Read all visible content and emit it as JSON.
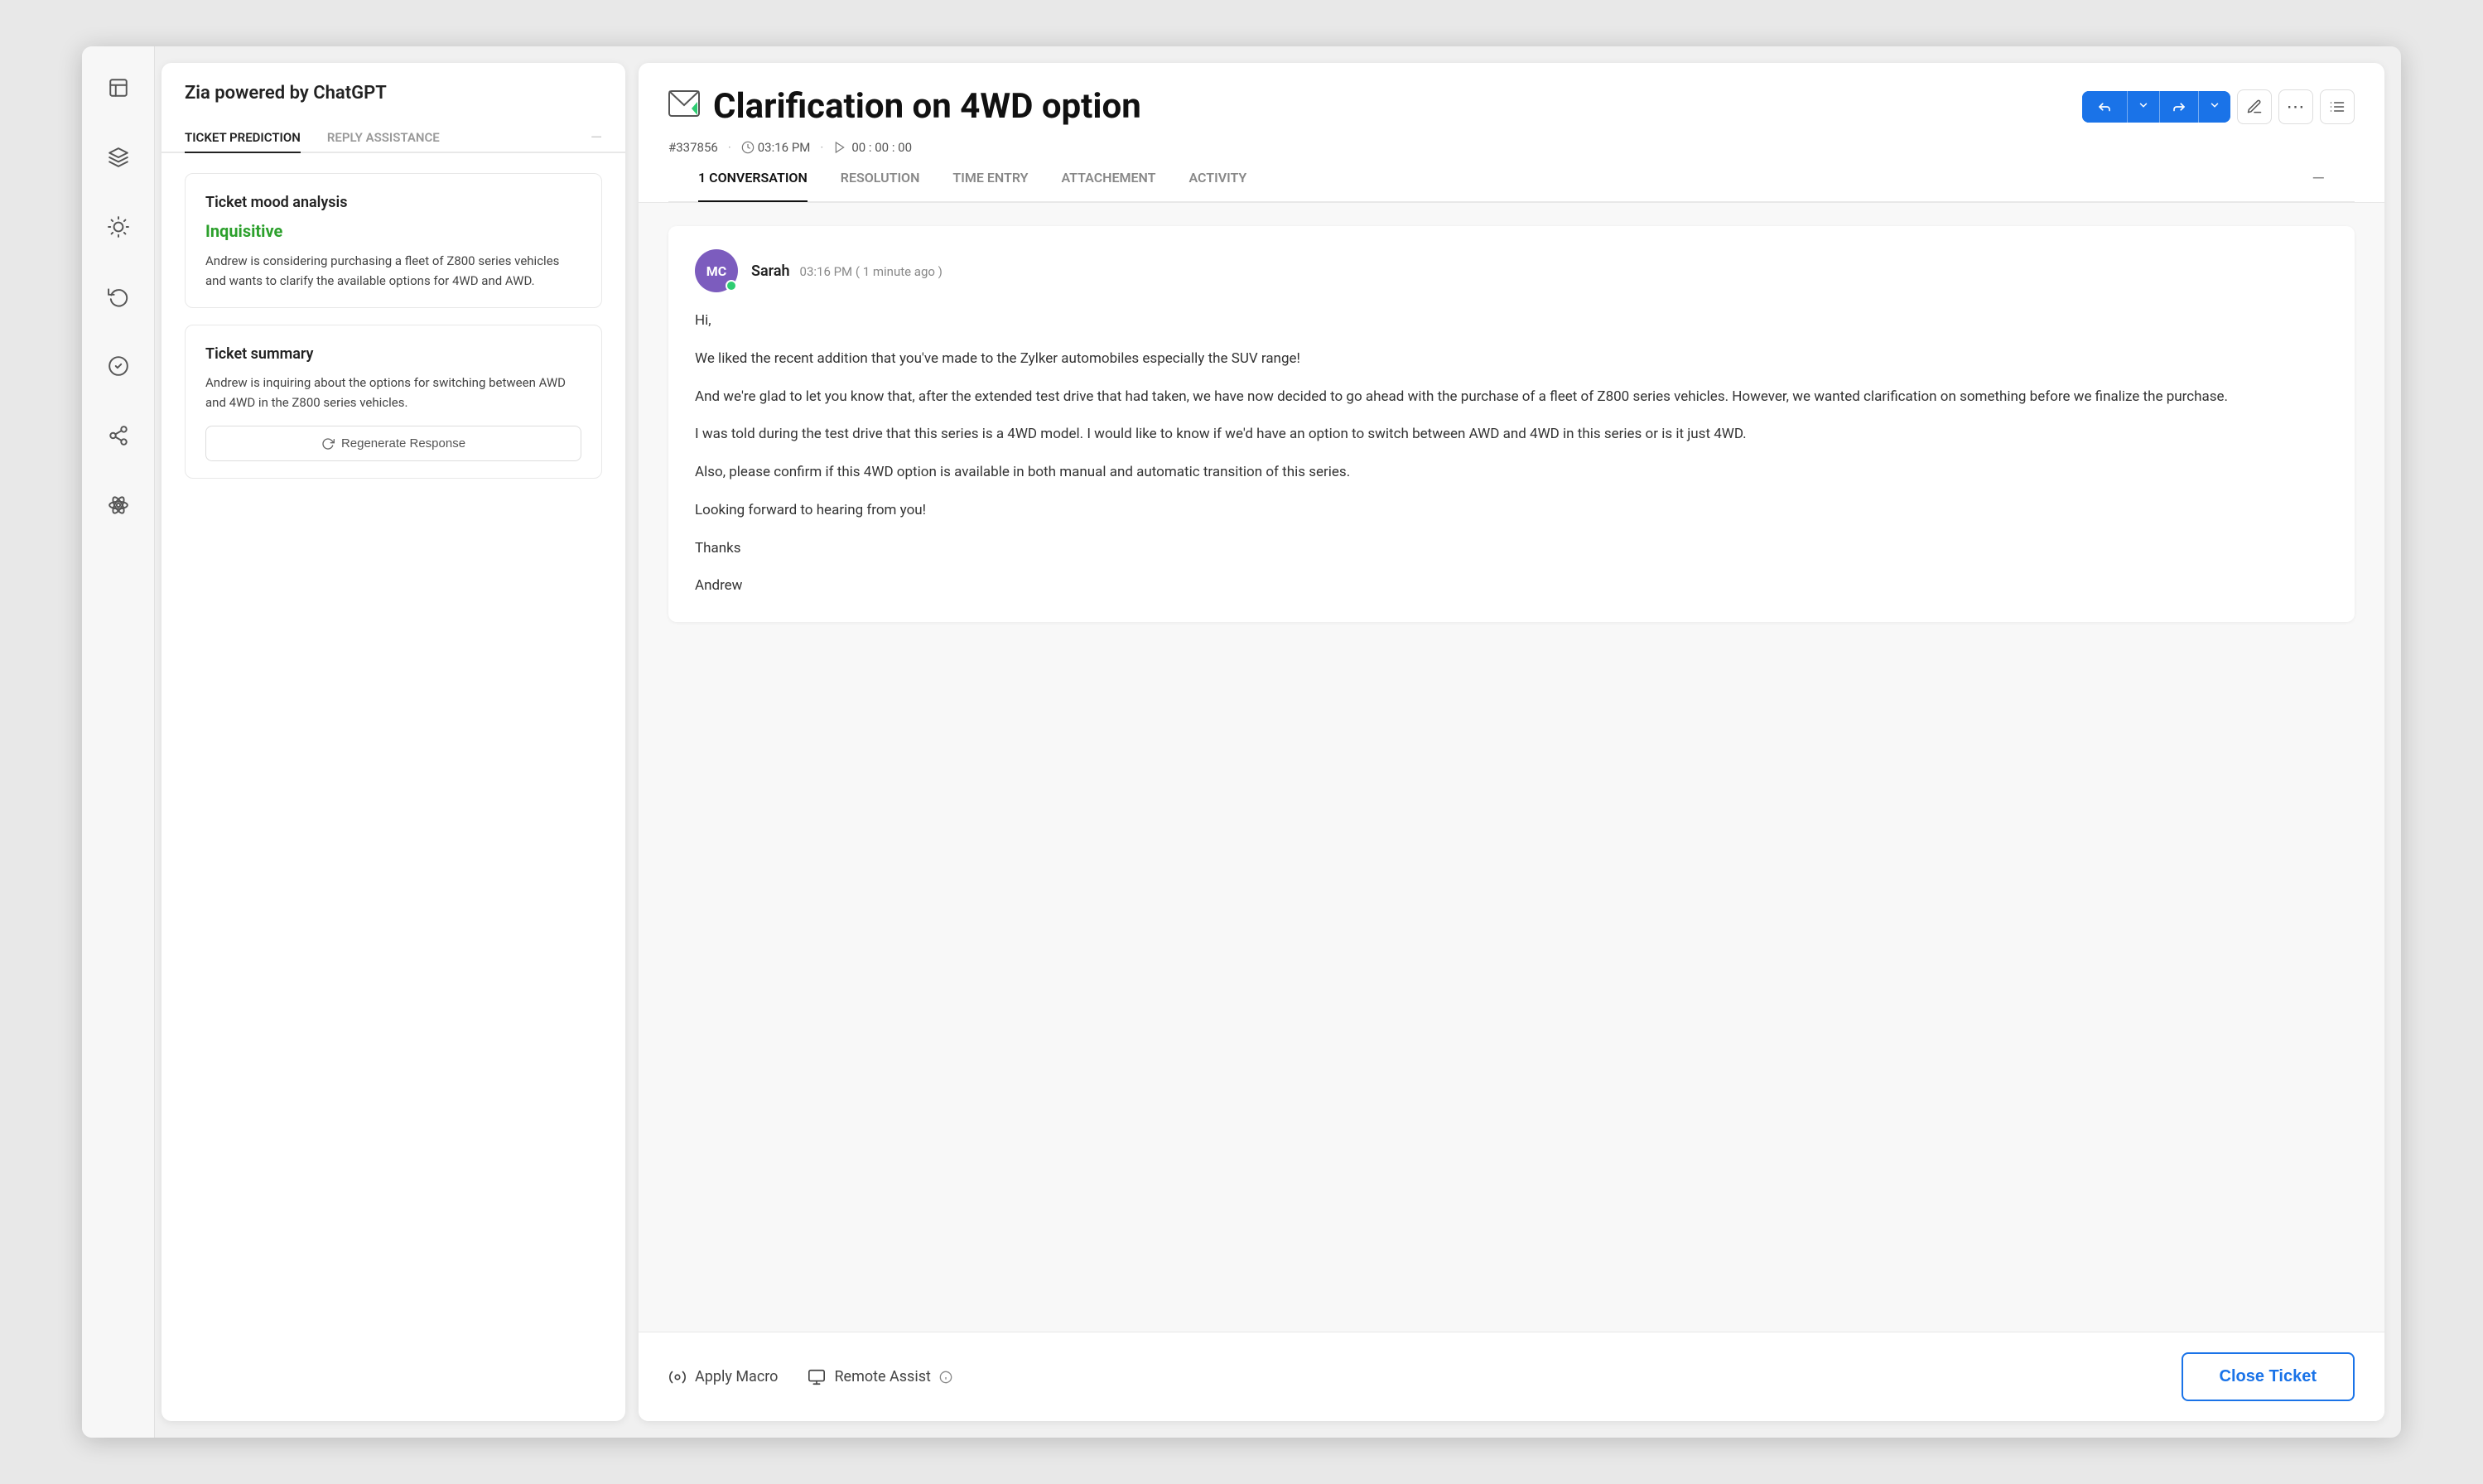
{
  "zia": {
    "title": "Zia powered by ChatGPT",
    "tabs": [
      {
        "label": "TICKET PREDICTION",
        "active": true
      },
      {
        "label": "REPLY ASSISTANCE",
        "active": false
      }
    ],
    "mood_card": {
      "title": "Ticket mood analysis",
      "mood": "Inquisitive",
      "text": "Andrew is considering purchasing a fleet of Z800 series vehicles and wants to clarify the available options for 4WD and AWD."
    },
    "summary_card": {
      "title": "Ticket summary",
      "text": "Andrew is inquiring about the options for switching between AWD and 4WD in the Z800 series vehicles.",
      "regenerate_label": "Regenerate Response"
    }
  },
  "ticket": {
    "title": "Clarification on 4WD option",
    "id": "#337856",
    "time": "03:16 PM",
    "timer": "00 : 00 : 00",
    "tabs": [
      {
        "label": "1 CONVERSATION",
        "active": true
      },
      {
        "label": "RESOLUTION",
        "active": false
      },
      {
        "label": "TIME ENTRY",
        "active": false
      },
      {
        "label": "ATTACHEMENT",
        "active": false
      },
      {
        "label": "ACTIVITY",
        "active": false
      }
    ],
    "message": {
      "sender": "Sarah",
      "avatar_initials": "MC",
      "time": "03:16 PM ( 1 minute ago )",
      "body_lines": [
        "Hi,",
        "We liked the recent addition that you've made to the Zylker automobiles especially the SUV range!",
        "And we're glad to let you know that, after the extended test drive that had taken, we have now decided to go ahead with the purchase of a fleet of Z800 series vehicles. However, we wanted clarification on something before we finalize the purchase.",
        "I was told during the test drive that this series is a 4WD model. I would like to know if we'd have an option to switch between AWD and 4WD in this series or is it just 4WD.",
        "Also, please confirm if this 4WD option is available in both manual and automatic transition of this series.",
        "Looking forward to hearing from you!",
        "Thanks",
        "Andrew"
      ]
    }
  },
  "footer": {
    "apply_macro": "Apply Macro",
    "remote_assist": "Remote Assist",
    "close_ticket": "Close Ticket"
  },
  "icons": {
    "ticket_icon": "✉",
    "reply_icon": "↩",
    "forward_icon": "↪",
    "more_icon": "⋯",
    "filter_icon": "☰",
    "clock_icon": "🕐",
    "play_icon": "▶",
    "macro_icon": "⚙",
    "monitor_icon": "🖥",
    "info_icon": "ⓘ",
    "sparkle_icon": "✦"
  }
}
